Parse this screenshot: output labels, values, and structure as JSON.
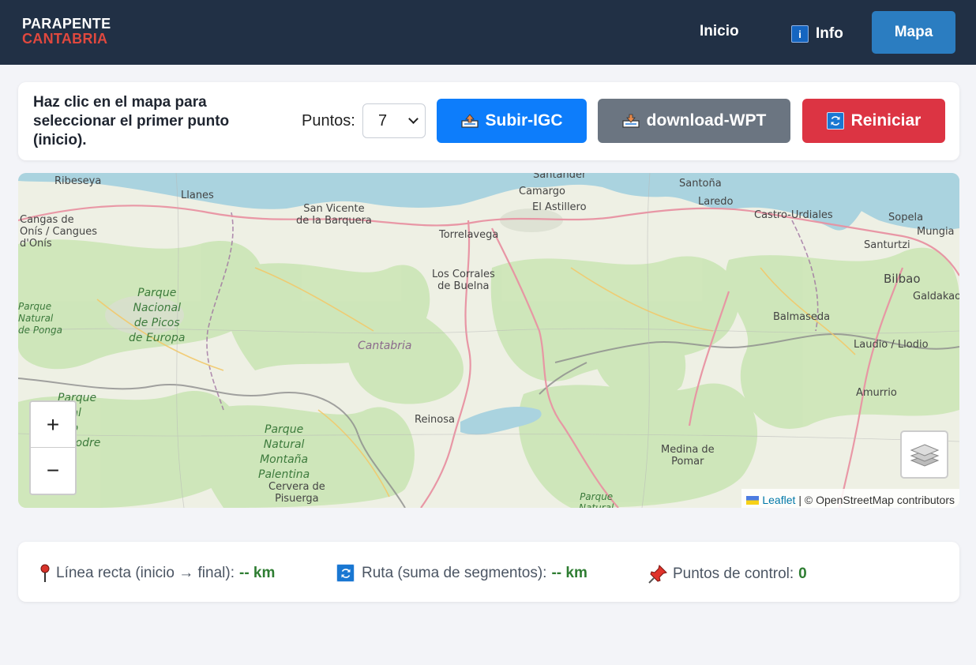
{
  "brand": {
    "line1": "PARAPENTE",
    "line2": "CANTABRIA"
  },
  "nav": {
    "inicio": "Inicio",
    "info": "Info",
    "info_icon": "info-icon",
    "mapa": "Mapa"
  },
  "controls": {
    "instruction": "Haz clic en el mapa para seleccionar el primer punto (inicio).",
    "puntos_label": "Puntos:",
    "puntos_value": "7",
    "upload_label": "Subir-IGC",
    "download_label": "download-WPT",
    "reset_label": "Reiniciar"
  },
  "map": {
    "places": {
      "ribeseya": "Ribeseya",
      "llanes": "Llanes",
      "santander": "Santander",
      "santona": "Santoña",
      "camargo": "Camargo",
      "el_astillero": "El Astillero",
      "laredo": "Laredo",
      "san_vicente": "San Vicente\nde la Barquera",
      "cangas": "Cangas de\nOnís / Cangues\nd'Onís",
      "torrelavega": "Torrelavega",
      "castro": "Castro-Urdiales",
      "sopela": "Sopela",
      "mungia": "Mungia",
      "santurtzi": "Santurtzi",
      "los_corrales": "Los Corrales\nde Buelna",
      "bilbao": "Bilbao",
      "galdakao": "Galdakao",
      "balmaseda": "Balmaseda",
      "laudio": "Laudio / Llodio",
      "amurrio": "Amurrio",
      "reinosa": "Reinosa",
      "medina": "Medina de\nPomar",
      "cervera": "Cervera de\nPisuerga",
      "ponga": "Parque\nNatural\nde Ponga"
    },
    "parks": {
      "picos": "Parque\nNacional\nde Picos\nde Europa",
      "redes": "Parque\nonal\naño\nmpodre",
      "palentina": "Parque\nNatural\nMontaña\nPalentina",
      "bottom": "Parque\nNatural"
    },
    "region": "Cantabria",
    "zoom_in": "+",
    "zoom_out": "−",
    "attribution_link": "Leaflet",
    "attribution_text": "| © OpenStreetMap contributors"
  },
  "stats": {
    "linea_label": "Línea recta (inicio → final):",
    "linea_value": "-- km",
    "ruta_label": "Ruta (suma de segmentos):",
    "ruta_value": "-- km",
    "puntos_label": "Puntos de control:",
    "puntos_value": "0"
  }
}
